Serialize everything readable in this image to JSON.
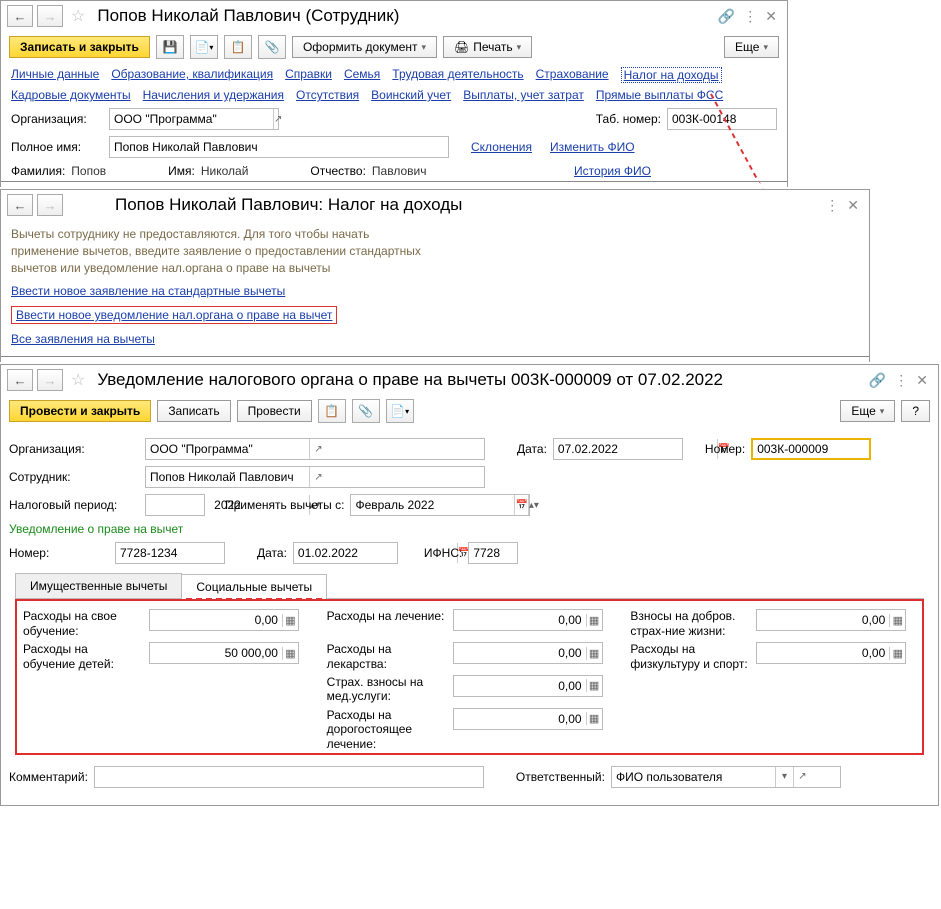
{
  "panel1": {
    "title": "Попов Николай Павлович (Сотрудник)",
    "save_close": "Записать и закрыть",
    "create_doc": "Оформить документ",
    "print": "Печать",
    "more": "Еще",
    "nav_links_row1": [
      "Личные данные",
      "Образование, квалификация",
      "Справки",
      "Семья",
      "Трудовая деятельность",
      "Страхование",
      "Налог на доходы"
    ],
    "nav_links_row2": [
      "Кадровые документы",
      "Начисления и удержания",
      "Отсутствия",
      "Воинский учет",
      "Выплаты, учет затрат",
      "Прямые выплаты ФСС"
    ],
    "org_label": "Организация:",
    "org_value": "ООО \"Программа\"",
    "tab_label": "Таб. номер:",
    "tab_value": "003К-00148",
    "fullname_label": "Полное имя:",
    "fullname_value": "Попов Николай Павлович",
    "decl_link": "Склонения",
    "edit_fio": "Изменить ФИО",
    "surname_label": "Фамилия:",
    "surname_value": "Попов",
    "name_label": "Имя:",
    "name_value": "Николай",
    "patr_label": "Отчество:",
    "patr_value": "Павлович",
    "history_fio": "История ФИО"
  },
  "panel2": {
    "title": "Попов Николай Павлович: Налог на доходы",
    "note": "Вычеты сотруднику не предоставляются. Для того чтобы начать применение вычетов, введите заявление о предоставлении стандартных вычетов или уведомление нал.органа о праве на вычеты",
    "link1": "Ввести новое заявление на стандартные вычеты",
    "link2": "Ввести новое уведомление нал.органа о праве на вычет",
    "link3": "Все заявления на вычеты"
  },
  "panel3": {
    "title": "Уведомление налогового органа о праве на вычеты 003К-000009 от 07.02.2022",
    "post_close": "Провести и закрыть",
    "save": "Записать",
    "post": "Провести",
    "more": "Еще",
    "help": "?",
    "org_label": "Организация:",
    "org_value": "ООО \"Программа\"",
    "date_label": "Дата:",
    "date_value": "07.02.2022",
    "num_label": "Номер:",
    "num_value": "003К-000009",
    "emp_label": "Сотрудник:",
    "emp_value": "Попов Николай Павлович",
    "tax_period_label": "Налоговый период:",
    "tax_period_value": "2022",
    "apply_from_label": "Применять вычеты с:",
    "apply_from_value": "Февраль 2022",
    "section_title": "Уведомление о праве на вычет",
    "n_label": "Номер:",
    "n_value": "7728-1234",
    "d_label": "Дата:",
    "d_value": "01.02.2022",
    "ifns_label": "ИФНС:",
    "ifns_value": "7728",
    "tabs": [
      "Имущественные вычеты",
      "Социальные вычеты"
    ],
    "rows": {
      "own_edu": {
        "label": "Расходы на свое обучение:",
        "value": "0,00"
      },
      "child_edu": {
        "label": "Расходы на обучение детей:",
        "value": "50 000,00"
      },
      "treat": {
        "label": "Расходы на лечение:",
        "value": "0,00"
      },
      "meds": {
        "label": "Расходы на лекарства:",
        "value": "0,00"
      },
      "med_ins": {
        "label": "Страх. взносы на мед.услуги:",
        "value": "0,00"
      },
      "exp_treat": {
        "label": "Расходы на дорогостоящее лечение:",
        "value": "0,00"
      },
      "life_ins": {
        "label": "Взносы на добров. страх-ние жизни:",
        "value": "0,00"
      },
      "sport": {
        "label": "Расходы на физкультуру и спорт:",
        "value": "0,00"
      }
    },
    "comment_label": "Комментарий:",
    "comment_value": "",
    "resp_label": "Ответственный:",
    "resp_value": "ФИО пользователя"
  }
}
